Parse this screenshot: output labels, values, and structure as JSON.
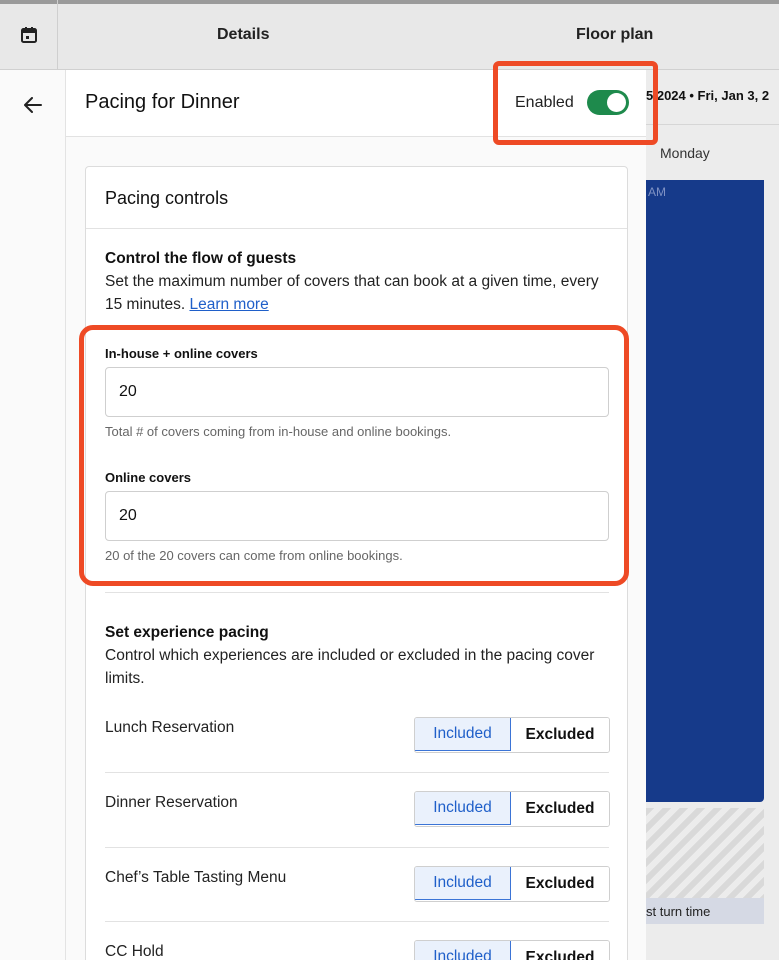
{
  "header": {
    "tabs": [
      {
        "label": "Details"
      },
      {
        "label": "Floor plan"
      }
    ]
  },
  "background": {
    "date_text": "5  2024 • Fri, Jan 3, 2",
    "day_label": "Monday",
    "time_label": "AM",
    "turn_time_label": "st turn time"
  },
  "panel": {
    "title": "Pacing for Dinner",
    "enabled_label": "Enabled",
    "enabled": true,
    "accent_color": "#1e8a4c"
  },
  "pacing_controls": {
    "title": "Pacing controls",
    "flow": {
      "title": "Control the flow of guests",
      "description": "Set the maximum number of covers that can book at a given time, every 15 minutes.",
      "learn_more": "Learn more"
    },
    "fields": [
      {
        "label": "In-house + online covers",
        "value": "20",
        "help": "Total # of covers coming from in-house and online bookings."
      },
      {
        "label": "Online covers",
        "value": "20",
        "help": "20 of the 20 covers can come from online bookings."
      }
    ],
    "experience": {
      "title": "Set experience pacing",
      "description": "Control which experiences are included or excluded in the pacing cover limits.",
      "included_label": "Included",
      "excluded_label": "Excluded",
      "rows": [
        {
          "name": "Lunch Reservation",
          "selected": "Included"
        },
        {
          "name": "Dinner Reservation",
          "selected": "Included"
        },
        {
          "name": "Chef’s Table Tasting Menu",
          "selected": "Included"
        },
        {
          "name": "CC Hold",
          "selected": "Included"
        }
      ]
    }
  },
  "colors": {
    "highlight": "#ee4a25",
    "link": "#1f5fc9",
    "calendar_block": "#163a8a"
  }
}
